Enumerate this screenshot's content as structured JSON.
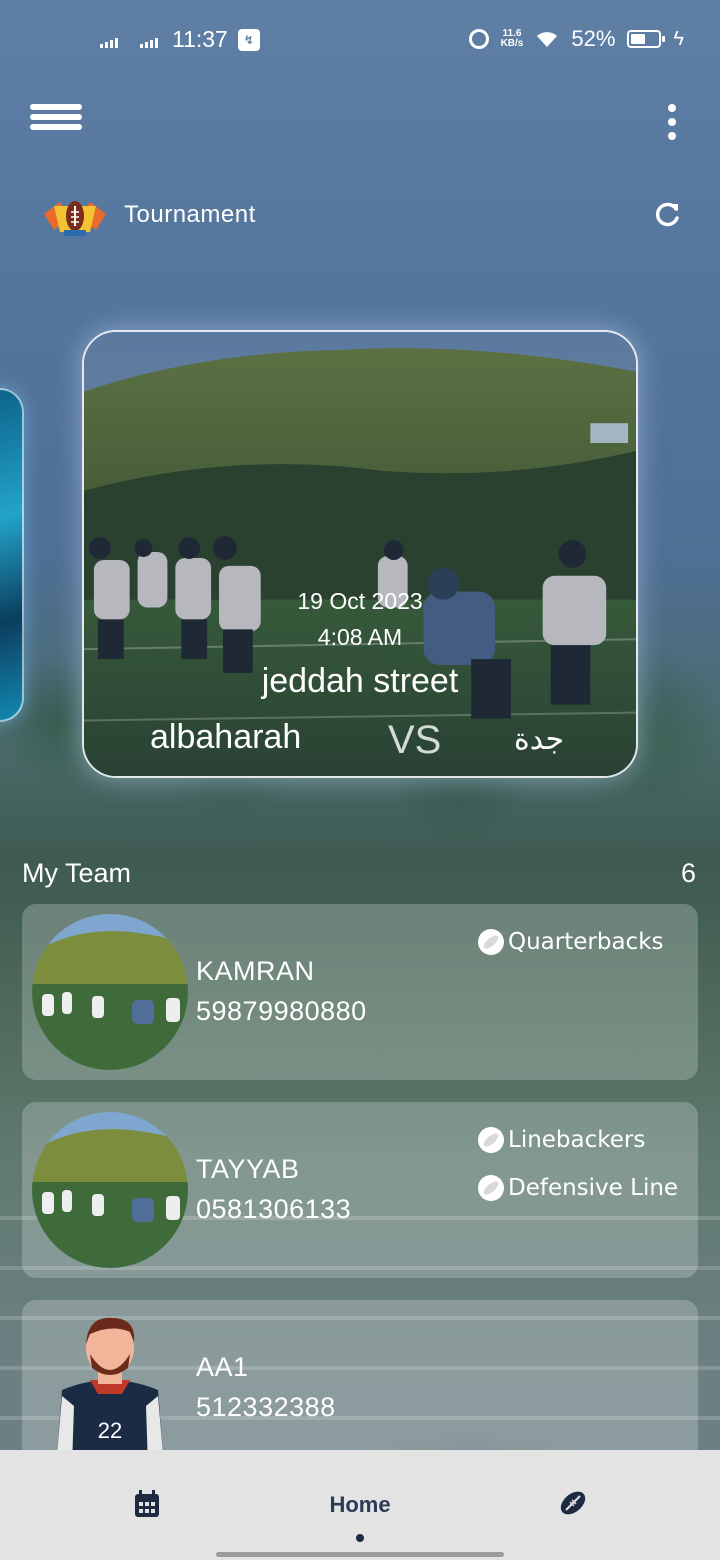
{
  "status_bar": {
    "time": "11:37",
    "network_speed_value": "11.6",
    "network_speed_unit": "KB/s",
    "battery_percent": "52%",
    "battery_level": 0.52
  },
  "app_bar": {
    "menu_icon": "hamburger-menu-icon",
    "more_icon": "more-vertical-icon"
  },
  "section": {
    "title": "Tournament",
    "refresh_icon": "refresh-icon"
  },
  "match": {
    "date": "19 Oct 2023",
    "time": "4:08 AM",
    "venue": "jeddah street",
    "home_team": "albaharah",
    "vs": "VS",
    "away_team": "جدة"
  },
  "my_team": {
    "title": "My Team",
    "count": "6",
    "players": [
      {
        "name": "KAMRAN",
        "phone": "59879980880",
        "positions": [
          "Quarterbacks"
        ]
      },
      {
        "name": "TAYYAB",
        "phone": "0581306133",
        "positions": [
          "Linebackers",
          "Defensive Line"
        ]
      },
      {
        "name": "AA1",
        "phone": "512332388",
        "positions": []
      }
    ]
  },
  "avatar_jersey_number": "22",
  "bottom_nav": {
    "calendar_icon": "calendar-icon",
    "home_label": "Home",
    "football_icon": "football-icon"
  },
  "colors": {
    "background": "#5f7fa5",
    "card_overlay": "rgba(255,255,255,0.22)",
    "nav_background": "#e3e3e3",
    "nav_text": "#2c3a54"
  }
}
